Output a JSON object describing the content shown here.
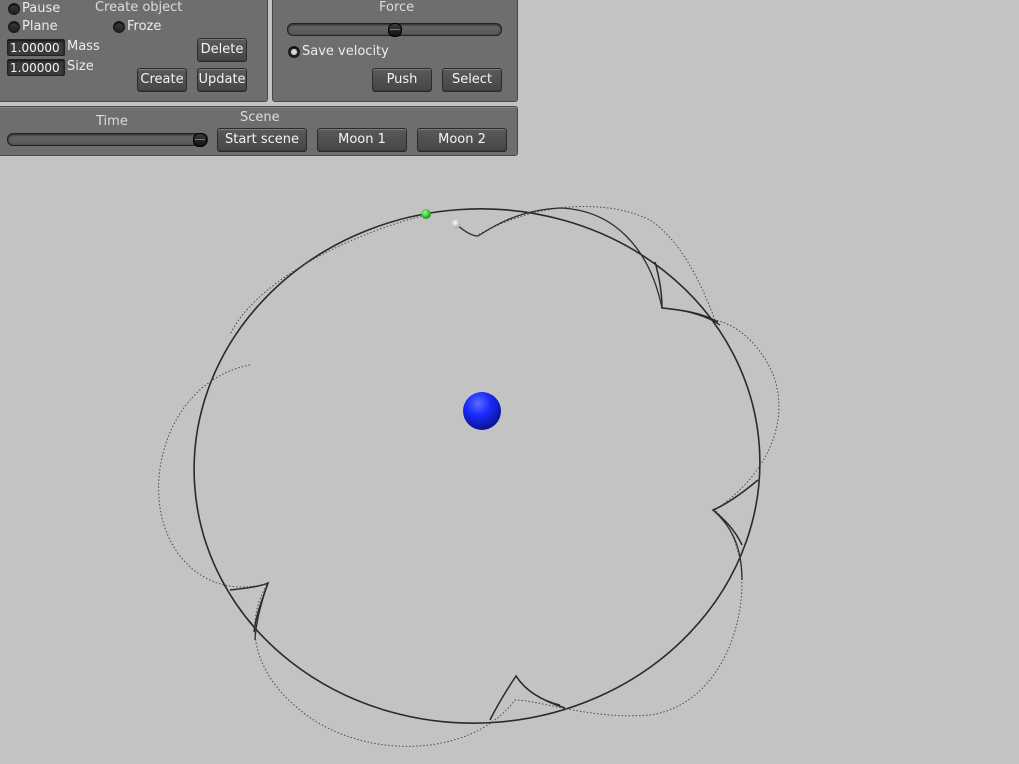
{
  "create_panel": {
    "pause_label": "Pause",
    "plane_label": "Plane",
    "froze_label": "Froze",
    "title": "Create object",
    "mass_value": "1.00000",
    "mass_label": "Mass",
    "size_value": "1.00000",
    "size_label": "Size",
    "delete_label": "Delete",
    "create_label": "Create",
    "update_label": "Update"
  },
  "force_panel": {
    "title": "Force",
    "slider_value": 0.5,
    "save_velocity_label": "Save velocity",
    "save_velocity_checked": true,
    "push_label": "Push",
    "select_label": "Select"
  },
  "scene_panel": {
    "time_label": "Time",
    "time_value": 1.0,
    "scene_label": "Scene",
    "start_scene_label": "Start scene",
    "moon1_label": "Moon 1",
    "moon2_label": "Moon 2"
  },
  "simulation": {
    "planet_color": "#1a2cff",
    "moon_green_color": "#22dd22",
    "moon_white_color": "#f2f2f2",
    "orbit_color": "#2a2a2a",
    "trail_color": "#3a3a3a"
  }
}
